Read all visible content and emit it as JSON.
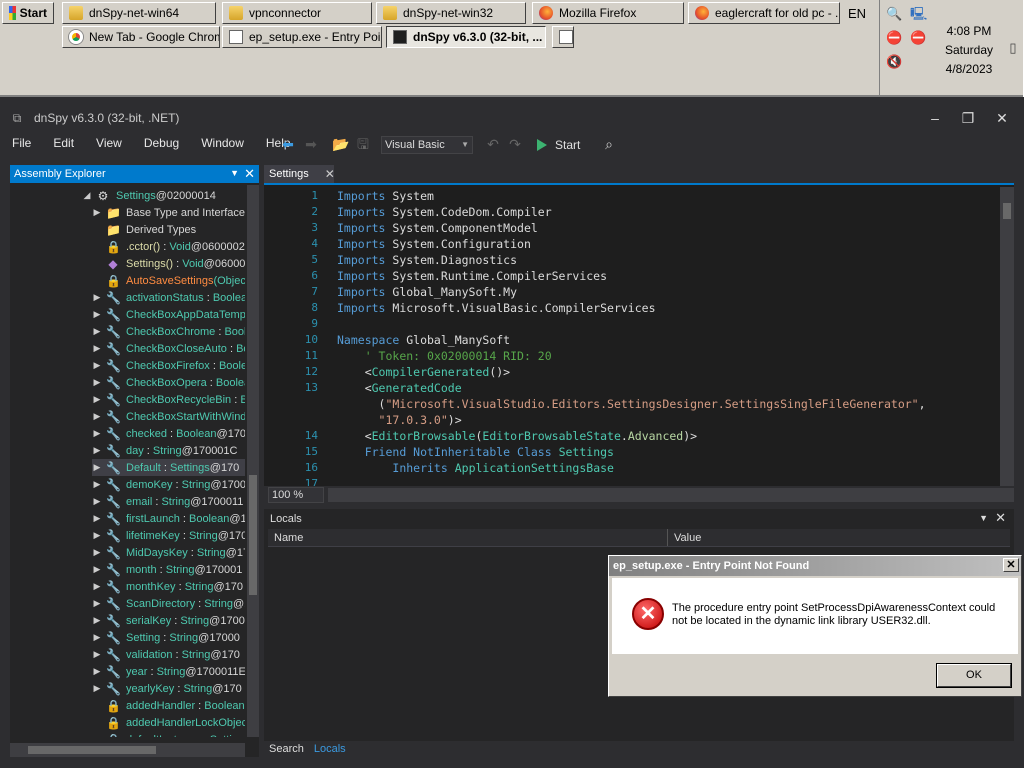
{
  "taskbar": {
    "start": "Start",
    "row1": [
      {
        "label": "dnSpy-net-win64",
        "icon": "folder"
      },
      {
        "label": "vpnconnector",
        "icon": "folder"
      },
      {
        "label": "dnSpy-net-win32",
        "icon": "folder"
      },
      {
        "label": "Mozilla Firefox",
        "icon": "firefox"
      },
      {
        "label": "eaglercraft for old pc - ...",
        "icon": "firefox"
      }
    ],
    "row2": [
      {
        "label": "New Tab - Google Chrome",
        "icon": "chrome"
      },
      {
        "label": "ep_setup.exe - Entry Poi...",
        "icon": "document"
      },
      {
        "label": "dnSpy v6.3.0 (32-bit, ...",
        "icon": "dnspy",
        "active": true
      }
    ],
    "language": "EN",
    "clock": {
      "time": "4:08 PM",
      "day": "Saturday",
      "date": "4/8/2023"
    }
  },
  "window": {
    "title": "dnSpy v6.3.0 (32-bit, .NET)",
    "menu": [
      "File",
      "Edit",
      "View",
      "Debug",
      "Window",
      "Help"
    ],
    "language_select": "Visual Basic",
    "start_label": "Start"
  },
  "assembly_explorer": {
    "title": "Assembly Explorer",
    "nodes": [
      {
        "indent": 3,
        "tw": "open",
        "icon": "gear",
        "name": "Settings",
        "tok": " @02000014",
        "kind": "type"
      },
      {
        "indent": 4,
        "tw": "closed",
        "icon": "folder",
        "name": "Base Type and Interface",
        "kind": "plain"
      },
      {
        "indent": 4,
        "tw": "",
        "icon": "folder",
        "name": "Derived Types",
        "kind": "plain"
      },
      {
        "indent": 4,
        "tw": "",
        "icon": "lockcube",
        "name": ".cctor()",
        "type": "Void",
        "tok": " @0600002",
        "kind": "method"
      },
      {
        "indent": 4,
        "tw": "",
        "icon": "cube",
        "name": "Settings()",
        "type": "Void",
        "tok": " @06000",
        "kind": "method"
      },
      {
        "indent": 4,
        "tw": "",
        "icon": "lockcube",
        "name": "AutoSaveSettings",
        "type": "(Objec",
        "kind": "orange"
      },
      {
        "indent": 4,
        "tw": "closed",
        "icon": "wrench",
        "name": "activationStatus",
        "type": "Boolea",
        "kind": "prop"
      },
      {
        "indent": 4,
        "tw": "closed",
        "icon": "wrench",
        "name": "CheckBoxAppDataTemp",
        "kind": "prop"
      },
      {
        "indent": 4,
        "tw": "closed",
        "icon": "wrench",
        "name": "CheckBoxChrome",
        "type": "Boole",
        "kind": "prop"
      },
      {
        "indent": 4,
        "tw": "closed",
        "icon": "wrench",
        "name": "CheckBoxCloseAuto",
        "type": "Bo",
        "kind": "prop"
      },
      {
        "indent": 4,
        "tw": "closed",
        "icon": "wrench",
        "name": "CheckBoxFirefox",
        "type": "Boole",
        "kind": "prop"
      },
      {
        "indent": 4,
        "tw": "closed",
        "icon": "wrench",
        "name": "CheckBoxOpera",
        "type": "Boolea",
        "kind": "prop"
      },
      {
        "indent": 4,
        "tw": "closed",
        "icon": "wrench",
        "name": "CheckBoxRecycleBin",
        "type": "Bo",
        "kind": "prop"
      },
      {
        "indent": 4,
        "tw": "closed",
        "icon": "wrench",
        "name": "CheckBoxStartWithWind",
        "kind": "prop"
      },
      {
        "indent": 4,
        "tw": "closed",
        "icon": "wrench",
        "name": "checked",
        "type": "Boolean",
        "tok": " @170",
        "kind": "prop"
      },
      {
        "indent": 4,
        "tw": "closed",
        "icon": "wrench",
        "name": "day",
        "type": "String",
        "tok": " @170001C",
        "kind": "prop"
      },
      {
        "indent": 4,
        "tw": "closed",
        "icon": "wrench",
        "name": "Default",
        "type": "Settings",
        "tok": " @170",
        "kind": "prop",
        "selected": true
      },
      {
        "indent": 4,
        "tw": "closed",
        "icon": "wrench",
        "name": "demoKey",
        "type": "String",
        "tok": " @1700",
        "kind": "prop"
      },
      {
        "indent": 4,
        "tw": "closed",
        "icon": "wrench",
        "name": "email",
        "type": "String",
        "tok": " @1700011",
        "kind": "prop"
      },
      {
        "indent": 4,
        "tw": "closed",
        "icon": "wrench",
        "name": "firstLaunch",
        "type": "Boolean",
        "tok": " @1",
        "kind": "prop"
      },
      {
        "indent": 4,
        "tw": "closed",
        "icon": "wrench",
        "name": "lifetimeKey",
        "type": "String",
        "tok": " @170",
        "kind": "prop"
      },
      {
        "indent": 4,
        "tw": "closed",
        "icon": "wrench",
        "name": "MidDaysKey",
        "type": "String",
        "tok": " @17",
        "kind": "prop"
      },
      {
        "indent": 4,
        "tw": "closed",
        "icon": "wrench",
        "name": "month",
        "type": "String",
        "tok": " @170001",
        "kind": "prop"
      },
      {
        "indent": 4,
        "tw": "closed",
        "icon": "wrench",
        "name": "monthKey",
        "type": "String",
        "tok": " @170",
        "kind": "prop"
      },
      {
        "indent": 4,
        "tw": "closed",
        "icon": "wrench",
        "name": "ScanDirectory",
        "type": "String",
        "tok": " @170",
        "kind": "prop"
      },
      {
        "indent": 4,
        "tw": "closed",
        "icon": "wrench",
        "name": "serialKey",
        "type": "String",
        "tok": " @1700",
        "kind": "prop"
      },
      {
        "indent": 4,
        "tw": "closed",
        "icon": "wrench",
        "name": "Setting",
        "type": "String",
        "tok": " @17000",
        "kind": "prop"
      },
      {
        "indent": 4,
        "tw": "closed",
        "icon": "wrench",
        "name": "validation",
        "type": "String",
        "tok": " @170",
        "kind": "prop"
      },
      {
        "indent": 4,
        "tw": "closed",
        "icon": "wrench",
        "name": "year",
        "type": "String",
        "tok": " @1700011E",
        "kind": "prop"
      },
      {
        "indent": 4,
        "tw": "closed",
        "icon": "wrench",
        "name": "yearlyKey",
        "type": "String",
        "tok": " @170",
        "kind": "prop"
      },
      {
        "indent": 4,
        "tw": "",
        "icon": "lockfield",
        "name": "addedHandler",
        "type": "Boolean",
        "kind": "prop"
      },
      {
        "indent": 4,
        "tw": "",
        "icon": "lockfield",
        "name": "addedHandlerLockObject",
        "kind": "prop"
      },
      {
        "indent": 4,
        "tw": "",
        "icon": "lockfield",
        "name": "defaultInstance",
        "type": "Settin",
        "kind": "prop"
      }
    ]
  },
  "editor": {
    "tab": "Settings",
    "zoom": "100 %",
    "lines": [
      {
        "n": "1",
        "html": "<span class=\"kw\">Imports</span> System"
      },
      {
        "n": "2",
        "html": "<span class=\"kw\">Imports</span> System.CodeDom.Compiler"
      },
      {
        "n": "3",
        "html": "<span class=\"kw\">Imports</span> System.ComponentModel"
      },
      {
        "n": "4",
        "html": "<span class=\"kw\">Imports</span> System.Configuration"
      },
      {
        "n": "5",
        "html": "<span class=\"kw\">Imports</span> System.Diagnostics"
      },
      {
        "n": "6",
        "html": "<span class=\"kw\">Imports</span> System.Runtime.CompilerServices"
      },
      {
        "n": "7",
        "html": "<span class=\"kw\">Imports</span> Global_ManySoft.My"
      },
      {
        "n": "8",
        "html": "<span class=\"kw\">Imports</span> Microsoft.VisualBasic.CompilerServices"
      },
      {
        "n": "9",
        "html": ""
      },
      {
        "n": "10",
        "html": "<span class=\"kw\">Namespace</span> Global_ManySoft"
      },
      {
        "n": "11",
        "html": "    <span class=\"cm\">' Token: 0x02000014 RID: 20</span>"
      },
      {
        "n": "12",
        "html": "    &lt;<span class=\"at\">CompilerGenerated</span>()&gt;"
      },
      {
        "n": "13",
        "html": "    &lt;<span class=\"at\">GeneratedCode</span>"
      },
      {
        "n": "",
        "html": "      (<span class=\"st\">\"Microsoft.VisualStudio.Editors.SettingsDesigner.SettingsSingleFileGenerator\"</span>,"
      },
      {
        "n": "",
        "html": "      <span class=\"st\">\"17.0.3.0\"</span>)&gt;"
      },
      {
        "n": "14",
        "html": "    &lt;<span class=\"at\">EditorBrowsable</span>(<span class=\"ty\">EditorBrowsableState</span>.<span class=\"en\">Advanced</span>)&gt;"
      },
      {
        "n": "15",
        "html": "    <span class=\"kw\">Friend NotInheritable Class</span> <span class=\"ty\">Settings</span>"
      },
      {
        "n": "16",
        "html": "        <span class=\"kw\">Inherits</span> <span class=\"ty\">ApplicationSettingsBase</span>"
      },
      {
        "n": "17",
        "html": ""
      }
    ]
  },
  "locals": {
    "title": "Locals",
    "col_name": "Name",
    "col_value": "Value"
  },
  "bottom_tabs": [
    "Search",
    "Locals"
  ],
  "dialog": {
    "title": "ep_setup.exe - Entry Point Not Found",
    "message": "The procedure entry point SetProcessDpiAwarenessContext could not be located in the dynamic link library USER32.dll.",
    "ok": "OK"
  }
}
